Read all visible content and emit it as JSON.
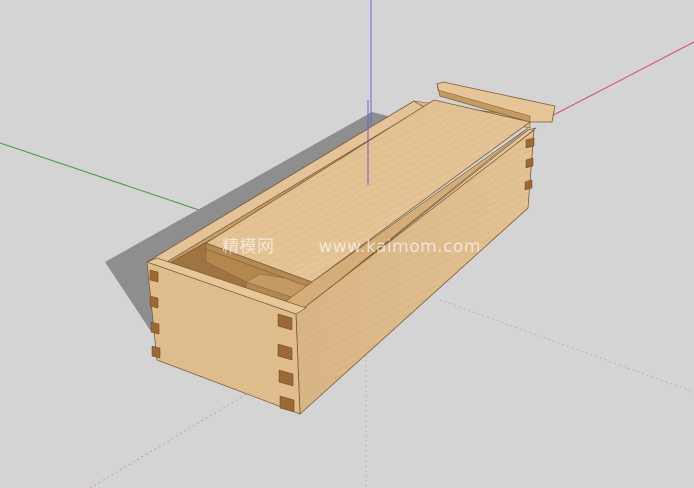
{
  "watermark": {
    "site_cn": "精模网",
    "site_url": "www.kaimom.com"
  },
  "colors": {
    "background": "#d4d4d4",
    "axis_red": "#d94f6a",
    "axis_green": "#3f9a3f",
    "axis_blue": "#6a5fd0",
    "wood_light": "#e2c193",
    "wood_mid": "#d7b27f",
    "wood_dark": "#b88f5e",
    "end_grain": "#9c6836",
    "shadow": "#8e8e8e"
  },
  "scene": {
    "object": "wooden-box-with-sliding-lid",
    "axes": [
      "red-axis",
      "green-axis",
      "blue-axis"
    ]
  }
}
